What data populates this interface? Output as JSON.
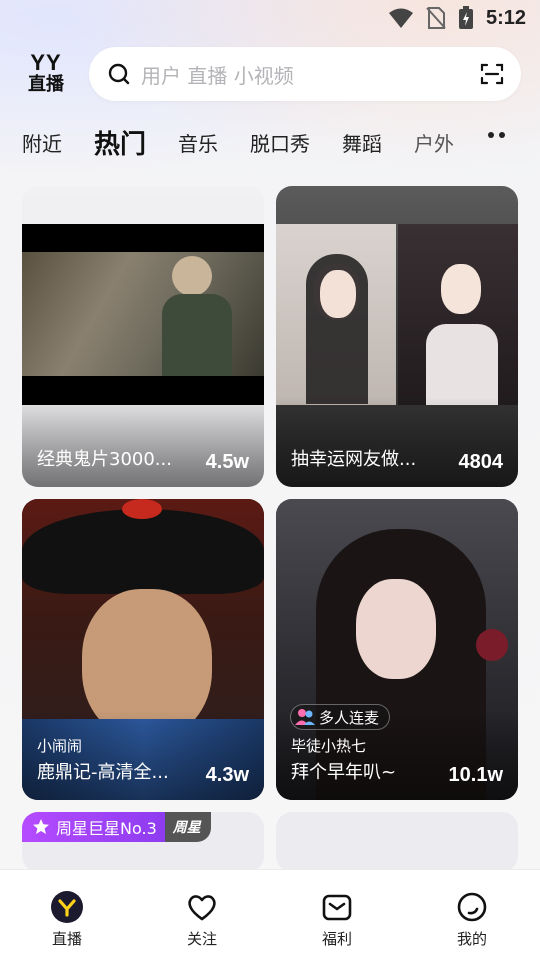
{
  "status_bar": {
    "time": "5:12"
  },
  "header": {
    "logo_top": "YY",
    "logo_bottom": "直播",
    "search_placeholder": "用户 直播 小视频"
  },
  "tabs": [
    {
      "label": "附近",
      "active": false
    },
    {
      "label": "热门",
      "active": true
    },
    {
      "label": "音乐",
      "active": false
    },
    {
      "label": "脱口秀",
      "active": false
    },
    {
      "label": "舞蹈",
      "active": false
    },
    {
      "label": "户外",
      "active": false
    }
  ],
  "cards": [
    {
      "title": "经典鬼片3000...",
      "count": "4.5w"
    },
    {
      "title": "抽幸运网友做...",
      "count": "4804"
    },
    {
      "subtitle": "小闹闹",
      "title": "鹿鼎记-高清全...",
      "count": "4.3w"
    },
    {
      "badge": "多人连麦",
      "subtitle": "毕徒小热七",
      "title": "拜个早年叭~",
      "count": "10.1w"
    },
    {
      "star_badge": "周星巨星No.3",
      "week_tag": "周星"
    }
  ],
  "bottom_nav": [
    {
      "label": "直播",
      "active": true
    },
    {
      "label": "关注",
      "active": false
    },
    {
      "label": "福利",
      "active": false
    },
    {
      "label": "我的",
      "active": false
    }
  ],
  "colors": {
    "accent_purple": "#a544f7",
    "nav_active": "#1a1a1a",
    "live_yellow": "#ffd21a"
  }
}
